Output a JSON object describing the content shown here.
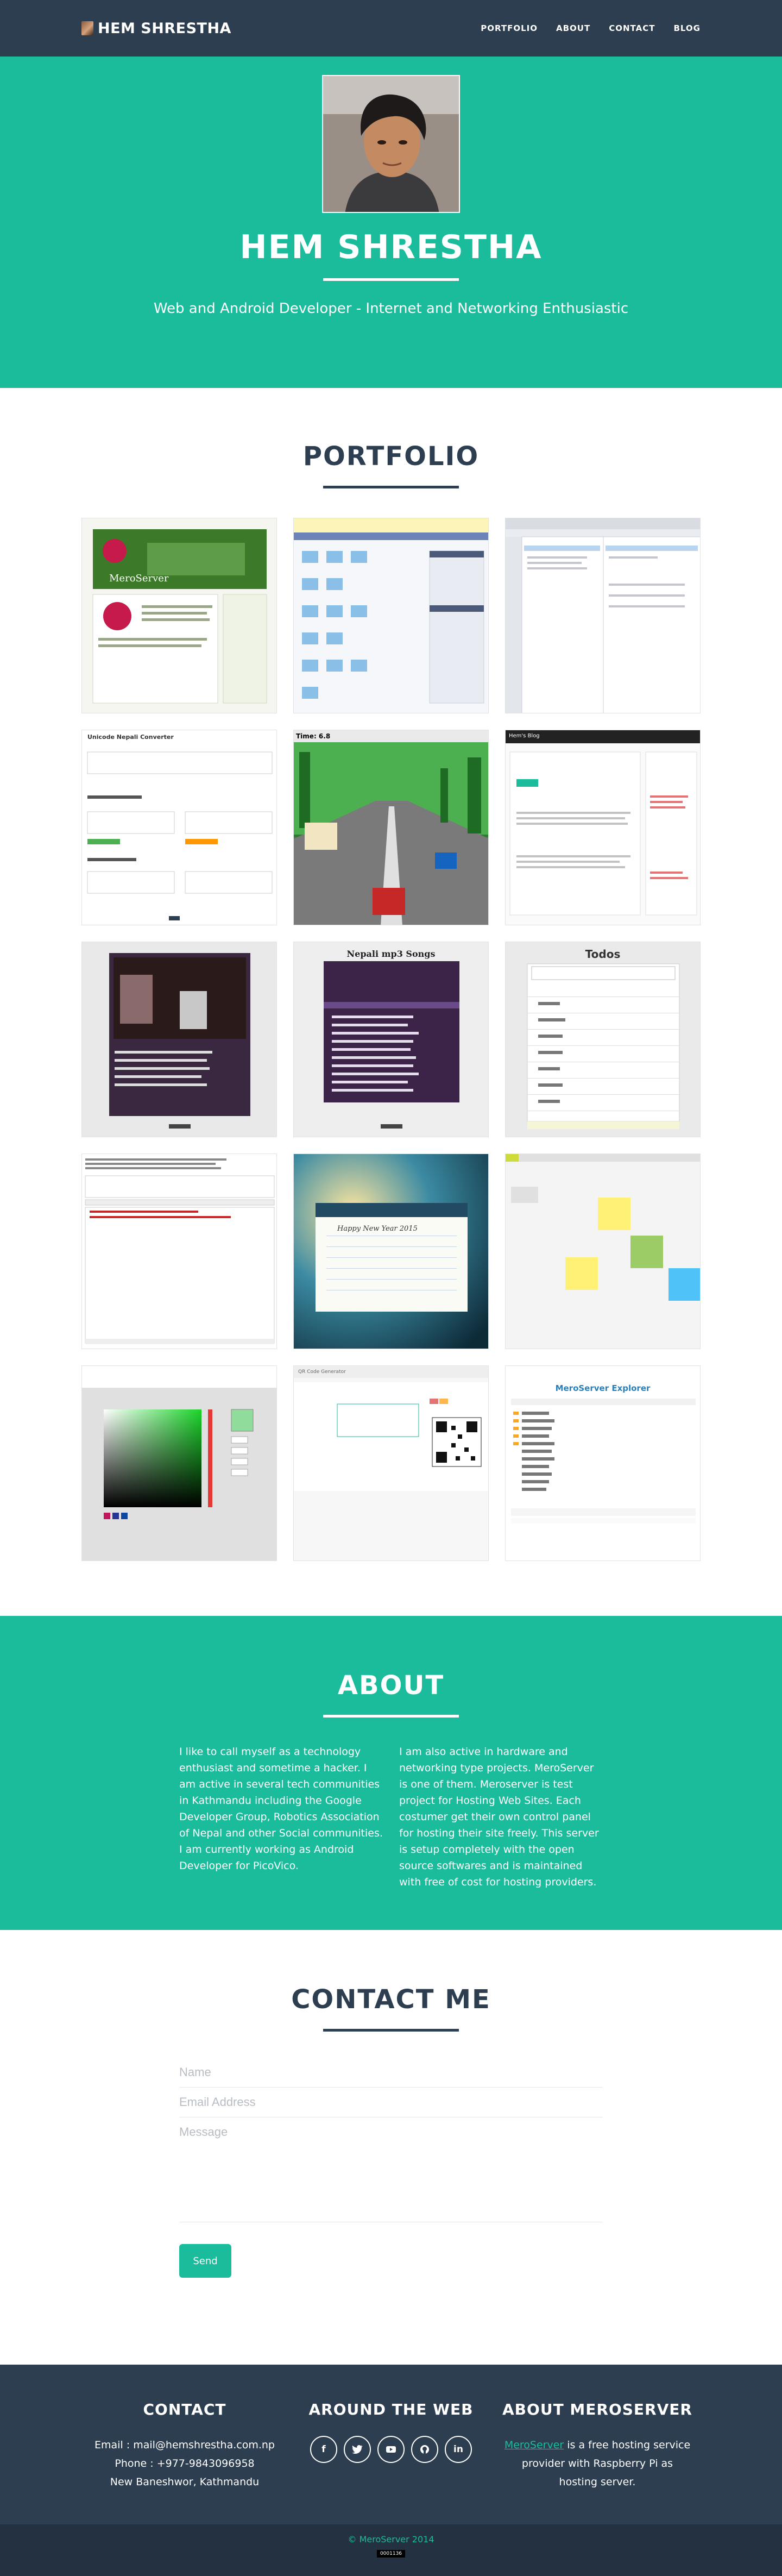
{
  "nav": {
    "brand": "HEM SHRESTHA",
    "links": [
      "PORTFOLIO",
      "ABOUT",
      "CONTACT",
      "BLOG"
    ]
  },
  "header": {
    "name": "HEM SHRESTHA",
    "tagline": "Web and Android Developer - Internet and Networking Enthusiastic"
  },
  "portfolio": {
    "title": "PORTFOLIO",
    "items": [
      {
        "caption": "MeroServer"
      },
      {
        "caption": ""
      },
      {
        "caption": ""
      },
      {
        "caption": "Unicode Nepali Converter"
      },
      {
        "caption": "Time: 6.8"
      },
      {
        "caption": "Hem's Blog"
      },
      {
        "caption": ""
      },
      {
        "caption": "Nepali mp3 Songs"
      },
      {
        "caption": "Todos"
      },
      {
        "caption": ""
      },
      {
        "caption": "Happy New Year 2015"
      },
      {
        "caption": ""
      },
      {
        "caption": ""
      },
      {
        "caption": "QR Code Generator"
      },
      {
        "caption": "MeroServer Explorer"
      }
    ]
  },
  "about": {
    "title": "ABOUT",
    "left": "I like to call myself as a technology enthusiast and sometime a hacker. I am active in several tech communities in Kathmandu including the Google Developer Group, Robotics Association of Nepal and other Social communities. I am currently working as Android Developer for PicoVico.",
    "right": "I am also active in hardware and networking type projects. MeroServer is one of them. Meroserver is test project for Hosting Web Sites. Each costumer get their own control panel for hosting their site freely. This server is setup completely with the open source softwares and is maintained with free of cost for hosting providers."
  },
  "contact": {
    "title": "CONTACT ME",
    "name_placeholder": "Name",
    "email_placeholder": "Email Address",
    "message_placeholder": "Message",
    "send_label": "Send"
  },
  "footer": {
    "contact_title": "CONTACT",
    "email": "Email : mail@hemshrestha.com.np",
    "phone": "Phone : +977-9843096958",
    "address": "New Baneshwor, Kathmandu",
    "web_title": "AROUND THE WEB",
    "social_icons": [
      "facebook-icon",
      "twitter-icon",
      "youtube-icon",
      "github-icon",
      "linkedin-icon"
    ],
    "about_title": "ABOUT MEROSERVER",
    "about_link": "MeroServer",
    "about_text": " is a free hosting service provider with Raspberry Pi as hosting server.",
    "copyright": "© MeroServer 2014"
  },
  "colors": {
    "accent": "#1abc9c",
    "dark": "#2c3e50",
    "footer_bottom": "#233140"
  }
}
